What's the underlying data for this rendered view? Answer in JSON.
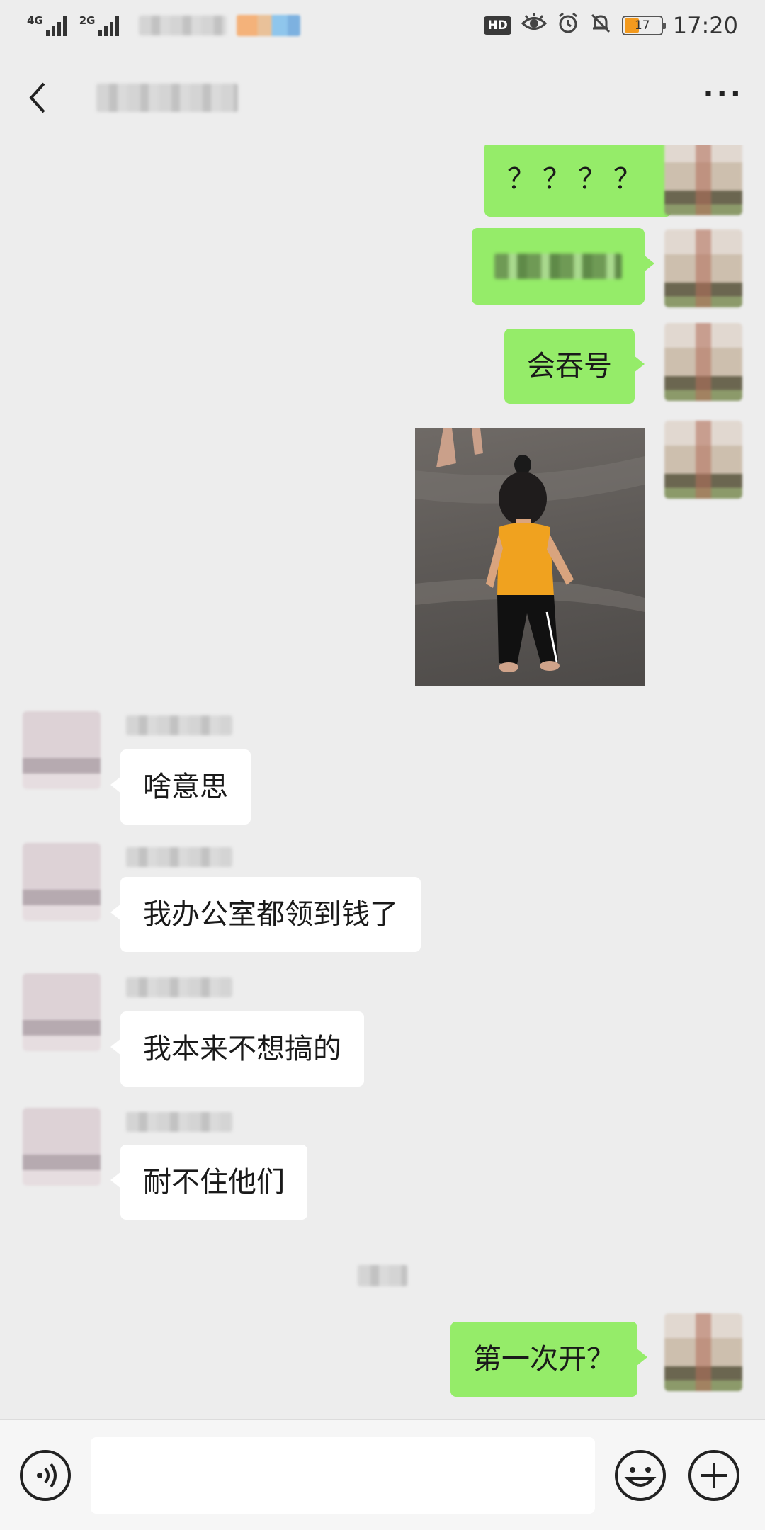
{
  "status_bar": {
    "signal1_label": "4G",
    "signal2_label": "2G",
    "hd_badge": "HD",
    "battery_level": "17",
    "time": "17:20",
    "icons": [
      "eye-icon",
      "alarm-icon",
      "bell-muted-icon"
    ]
  },
  "header": {
    "back_icon": "back-chevron-icon",
    "more_label": "···"
  },
  "messages": [
    {
      "side": "me",
      "text": "？？？？"
    },
    {
      "side": "me",
      "text": ""
    },
    {
      "side": "me",
      "text": "会吞号"
    },
    {
      "side": "me",
      "type": "image",
      "icon": "photo-child-image"
    },
    {
      "side": "them",
      "text": "啥意思"
    },
    {
      "side": "them",
      "text": "我办公室都领到钱了"
    },
    {
      "side": "them",
      "text": "我本来不想搞的"
    },
    {
      "side": "them",
      "text": "耐不住他们"
    },
    {
      "side": "me",
      "text": "第一次开？"
    }
  ],
  "input_bar": {
    "voice_icon": "voice-icon",
    "emoji_icon": "emoji-icon",
    "plus_icon": "plus-icon",
    "input_value": ""
  },
  "colors": {
    "background": "#ededed",
    "my_bubble": "#95ec69",
    "their_bubble": "#ffffff",
    "battery": "#f39a1e"
  }
}
